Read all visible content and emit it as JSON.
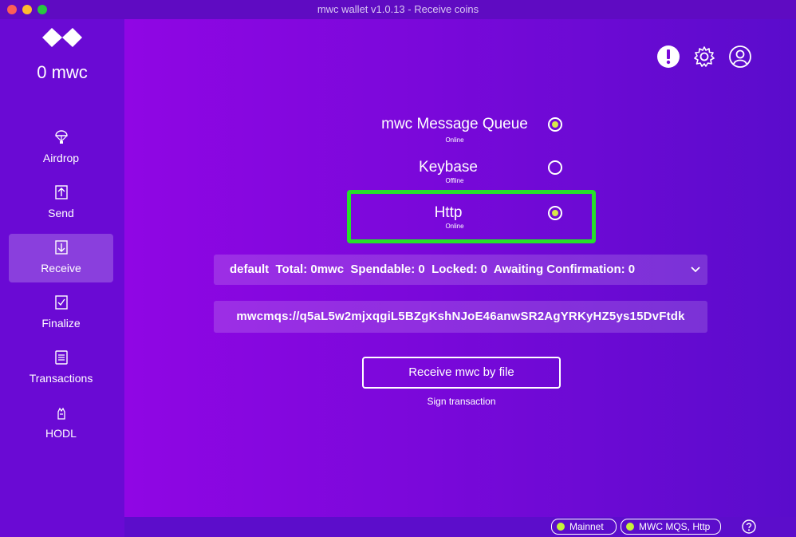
{
  "window": {
    "title": "mwc wallet v1.0.13 - Receive coins"
  },
  "sidebar": {
    "balance": "0 mwc",
    "items": [
      {
        "label": "Airdrop",
        "icon": "parachute-icon"
      },
      {
        "label": "Send",
        "icon": "arrow-up-icon"
      },
      {
        "label": "Receive",
        "icon": "arrow-down-icon",
        "active": true
      },
      {
        "label": "Finalize",
        "icon": "checkbox-icon"
      },
      {
        "label": "Transactions",
        "icon": "document-list-icon"
      },
      {
        "label": "HODL",
        "icon": "hand-icon"
      }
    ]
  },
  "topbar": {
    "icons": [
      "notification-icon",
      "gear-icon",
      "account-icon"
    ]
  },
  "channels": [
    {
      "name": "mwc Message Queue",
      "status": "Online",
      "selected": true
    },
    {
      "name": "Keybase",
      "status": "Offline",
      "selected": false
    },
    {
      "name": "Http",
      "status": "Online",
      "selected": true
    }
  ],
  "account": {
    "selected": "default  Total: 0mwc  Spendable: 0  Locked: 0  Awaiting Confirmation: 0"
  },
  "address": "mwcmqs://q5aL5w2mjxqgiL5BZgKshNJoE46anwSR2AgYRKyHZ5ys15DvFtdk",
  "actions": {
    "receive_file": "Receive mwc by file",
    "sign_transaction": "Sign transaction"
  },
  "statusbar": {
    "network": "Mainnet",
    "listeners": "MWC MQS, Http"
  },
  "colors": {
    "accent_green": "#26e02a",
    "radio_dot": "#d6e84a",
    "status_dot": "#c6f23a",
    "sidebar_bg": "#6a0ad4"
  }
}
